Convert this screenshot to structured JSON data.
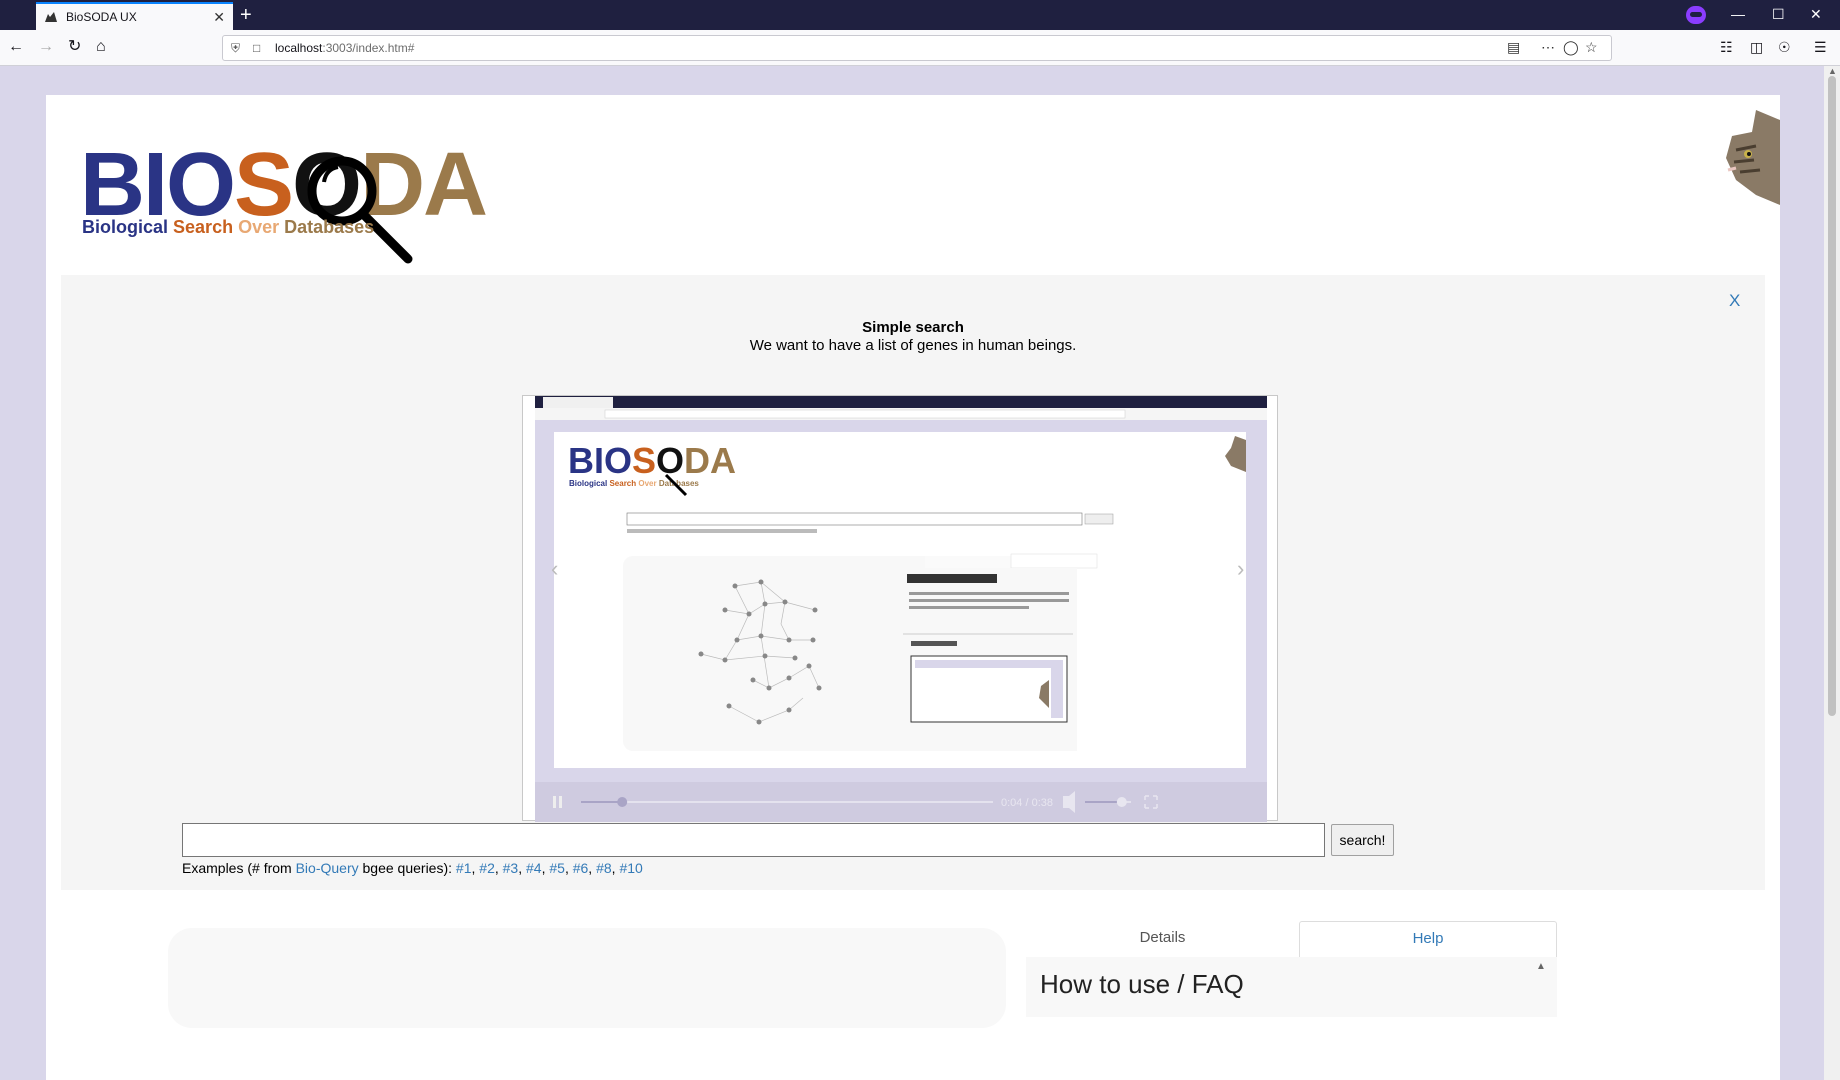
{
  "browser": {
    "tab_title": "BioSODA UX",
    "tab_close": "✕",
    "new_tab": "+",
    "url_host": "localhost",
    "url_rest": ":3003/index.htm#"
  },
  "page": {
    "logo": {
      "bio": "BIO",
      "s": "S",
      "o": "O",
      "da": "DA",
      "tag_biological": "Biological",
      "tag_search": "Search",
      "tag_over": "Over",
      "tag_databases": "Databases"
    },
    "tutorial": {
      "close": "X",
      "heading": "Simple search",
      "description": "We want to have a list of genes in human beings.",
      "video": {
        "time": "0:04 / 0:38",
        "progress": 0.1,
        "volume": 0.8
      },
      "slides": 2,
      "active_slide": 1
    },
    "search": {
      "value": "",
      "button": "search!",
      "examples_prefix": "Examples (# from ",
      "examples_link": "Bio-Query",
      "examples_middle": " bgee queries): ",
      "examples": [
        "#1",
        "#2",
        "#3",
        "#4",
        "#5",
        "#6",
        "#8",
        "#10"
      ]
    },
    "tabs": {
      "details": "Details",
      "help": "Help"
    },
    "help": {
      "title": "How to use / FAQ"
    }
  }
}
